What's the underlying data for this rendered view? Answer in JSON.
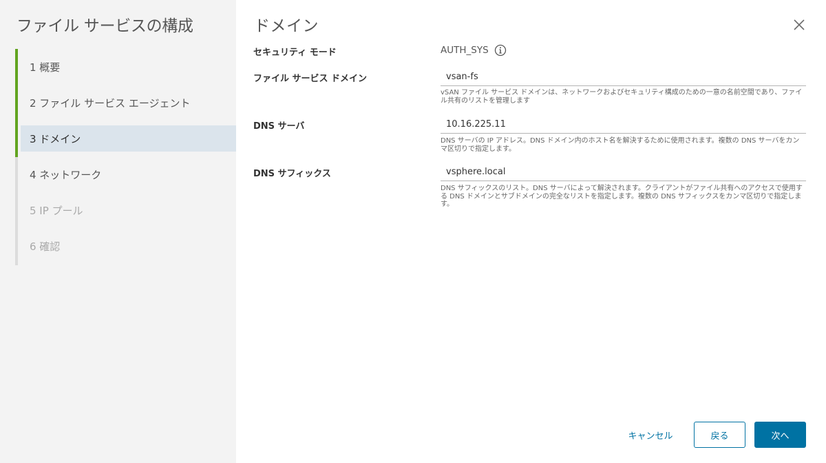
{
  "wizard": {
    "title": "ファイル サービスの構成"
  },
  "steps": [
    {
      "label": "1 概要",
      "state": "completed"
    },
    {
      "label": "2 ファイル サービス エージェント",
      "state": "completed"
    },
    {
      "label": "3 ドメイン",
      "state": "active"
    },
    {
      "label": "4 ネットワーク",
      "state": "pending"
    },
    {
      "label": "5 IP プール",
      "state": "disabled"
    },
    {
      "label": "6 確認",
      "state": "disabled"
    }
  ],
  "page": {
    "title": "ドメイン"
  },
  "form": {
    "security_mode": {
      "label": "セキュリティ モード",
      "value": "AUTH_SYS"
    },
    "file_service_domain": {
      "label": "ファイル サービス ドメイン",
      "value": "vsan-fs",
      "help": "vSAN ファイル サービス ドメインは、ネットワークおよびセキュリティ構成のための一意の名前空間であり、ファイル共有のリストを管理します"
    },
    "dns_servers": {
      "label": "DNS サーバ",
      "value": "10.16.225.11",
      "help": "DNS サーバの IP アドレス。DNS ドメイン内のホスト名を解決するために使用されます。複数の DNS サーバをカンマ区切りで指定します。"
    },
    "dns_suffixes": {
      "label": "DNS サフィックス",
      "value": "vsphere.local",
      "help": "DNS サフィックスのリスト。DNS サーバによって解決されます。クライアントがファイル共有へのアクセスで使用する DNS ドメインとサブドメインの完全なリストを指定します。複数の DNS サフィックスをカンマ区切りで指定します。"
    }
  },
  "footer": {
    "cancel_label": "キャンセル",
    "back_label": "戻る",
    "next_label": "次へ"
  },
  "colors": {
    "accent": "#0072a3",
    "progress": "#62a420",
    "active_step_bg": "#dbe4ec",
    "sidebar_bg": "#f3f3f3"
  }
}
